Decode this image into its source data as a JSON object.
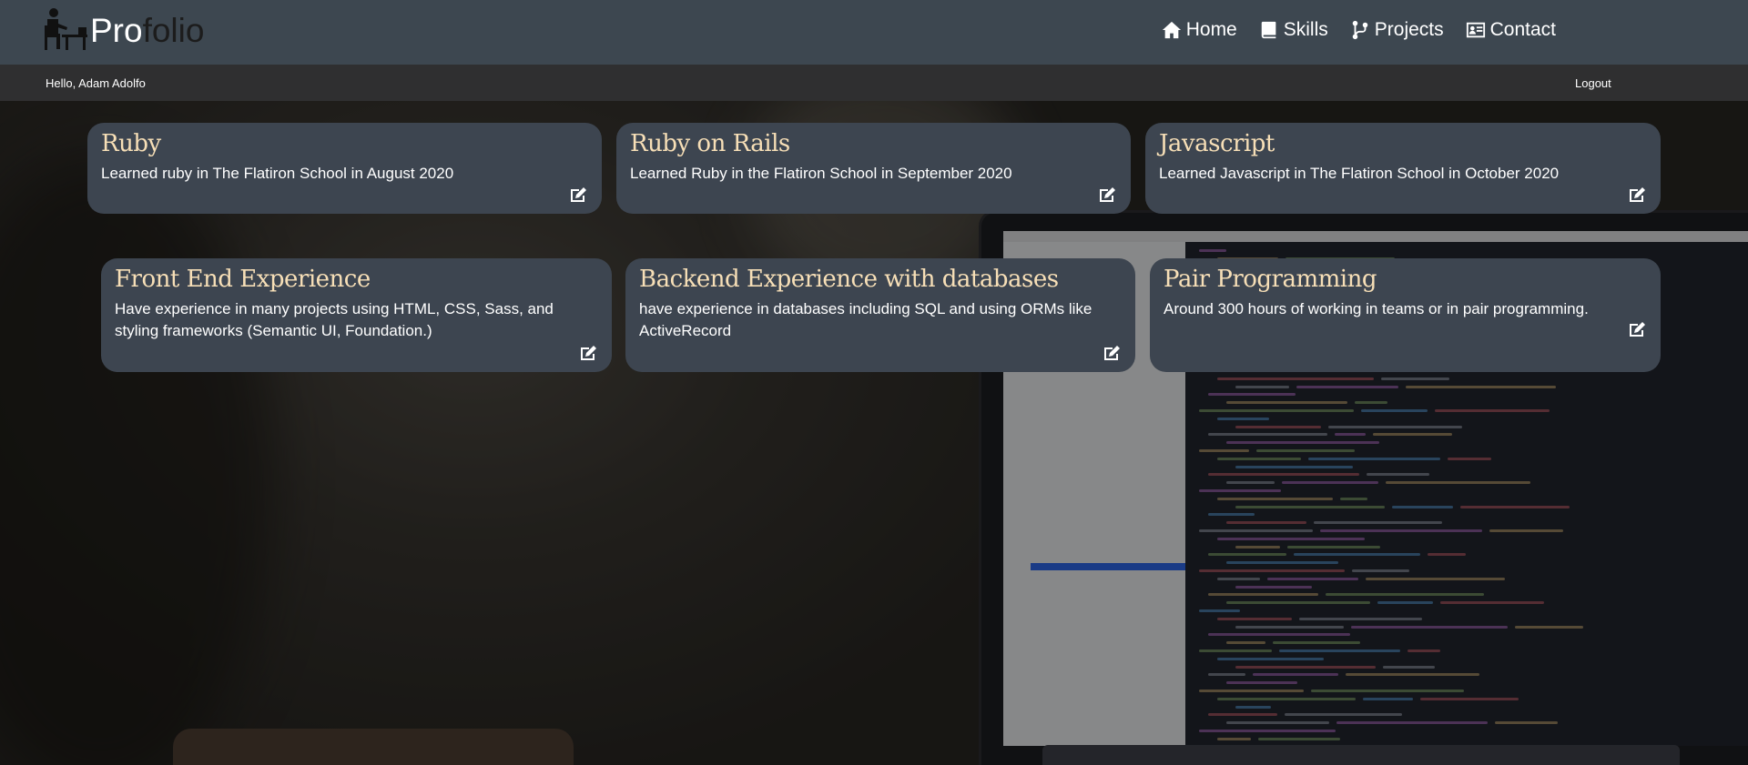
{
  "brand": {
    "pro": "Pro",
    "folio": "folio"
  },
  "nav": [
    {
      "label": "Home",
      "icon": "home-icon"
    },
    {
      "label": "Skills",
      "icon": "book-icon"
    },
    {
      "label": "Projects",
      "icon": "code-branch-icon"
    },
    {
      "label": "Contact",
      "icon": "address-card-icon"
    }
  ],
  "user": {
    "greeting": "Hello, Adam Adolfo",
    "logout": "Logout"
  },
  "skills": [
    {
      "title": "Ruby",
      "description": "Learned ruby in The Flatiron School in August 2020"
    },
    {
      "title": "Ruby on Rails",
      "description": "Learned Ruby in the Flatiron School in September 2020"
    },
    {
      "title": "Javascript",
      "description": "Learned Javascript in The Flatiron School in October 2020"
    },
    {
      "title": "Front End Experience",
      "description": "Have experience in many projects using HTML, CSS, Sass, and styling frameworks (Semantic UI, Foundation.)"
    },
    {
      "title": "Backend Experience with databases",
      "description": "have experience in databases including SQL and using ORMs like ActiveRecord"
    },
    {
      "title": "Pair Programming",
      "description": "Around 300 hours of working in teams or in pair programming."
    }
  ],
  "colors": {
    "navbar": "#3d4750",
    "userbar": "#2f2f30",
    "card": "#3d4550",
    "card_title": "#f7dfb7"
  }
}
